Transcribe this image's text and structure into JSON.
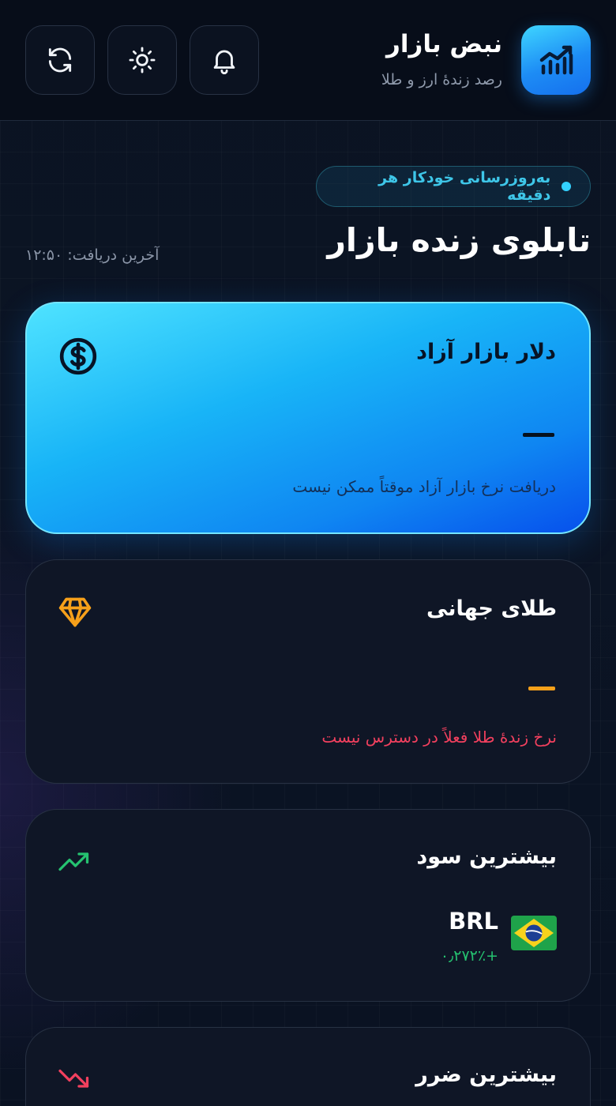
{
  "header": {
    "app_title": "نبض بازار",
    "app_subtitle": "رصد زندهٔ ارز و طلا",
    "icons": [
      "chart-icon",
      "bell-icon",
      "sun-icon",
      "refresh-icon"
    ]
  },
  "main": {
    "badge": "به‌روزرسانی خودکار هر دقیقه",
    "title": "تابلوی زنده بازار",
    "last_fetch": "آخرین دریافت: ۱۲:۵۰"
  },
  "cards": {
    "dollar": {
      "title": "دلار بازار آزاد",
      "note": "دریافت نرخ بازار آزاد موقتاً ممکن نیست",
      "icon": "dollar-icon"
    },
    "gold": {
      "title": "طلای جهانی",
      "note": "نرخ زندهٔ طلا فعلاً در دسترس نیست",
      "icon": "diamond-icon"
    },
    "gain": {
      "title": "بیشترین سود",
      "currency_code": "BRL",
      "change": "+۰٫۲۷۲٪",
      "icon": "trending-up-icon",
      "flag": "brazil-flag"
    },
    "loss": {
      "title": "بیشترین ضرر",
      "icon": "trending-down-icon"
    }
  },
  "colors": {
    "accent": "#18b4f7",
    "gold": "#f6a01a",
    "positive": "#25c270",
    "negative": "#f2405e"
  }
}
